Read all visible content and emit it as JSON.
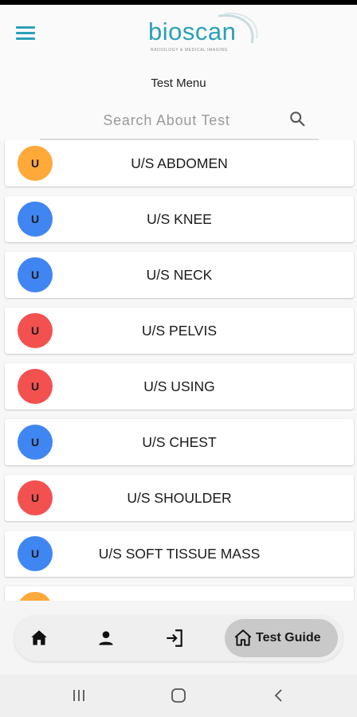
{
  "header": {
    "logo_text": "bioscan",
    "logo_tagline": "RADIOLOGY & MEDICAL IMAGING",
    "title": "Test Menu",
    "brand_color": "#2aa0b8"
  },
  "search": {
    "placeholder": "Search About Test",
    "value": ""
  },
  "tests": [
    {
      "initial": "U",
      "label": "U/S ABDOMEN",
      "color": "#ffa93a"
    },
    {
      "initial": "U",
      "label": "U/S KNEE",
      "color": "#3f86f2"
    },
    {
      "initial": "U",
      "label": "U/S NECK",
      "color": "#3f86f2"
    },
    {
      "initial": "U",
      "label": "U/S PELVIS",
      "color": "#f2514f"
    },
    {
      "initial": "U",
      "label": "U/S USING",
      "color": "#f2514f"
    },
    {
      "initial": "U",
      "label": "U/S CHEST",
      "color": "#3f86f2"
    },
    {
      "initial": "U",
      "label": "U/S SHOULDER",
      "color": "#f2514f"
    },
    {
      "initial": "U",
      "label": "U/S SOFT TISSUE MASS",
      "color": "#3f86f2"
    },
    {
      "initial": "",
      "label": "",
      "color": "#ffa93a"
    }
  ],
  "bottom_nav": {
    "items": [
      {
        "icon": "home-icon"
      },
      {
        "icon": "person-icon"
      },
      {
        "icon": "login-icon"
      }
    ],
    "active": {
      "icon": "home-outline-icon",
      "label": "Test Guide"
    }
  },
  "system_nav": {
    "items": [
      {
        "icon": "recent-apps-icon"
      },
      {
        "icon": "home-circle-icon"
      },
      {
        "icon": "back-icon"
      }
    ]
  }
}
